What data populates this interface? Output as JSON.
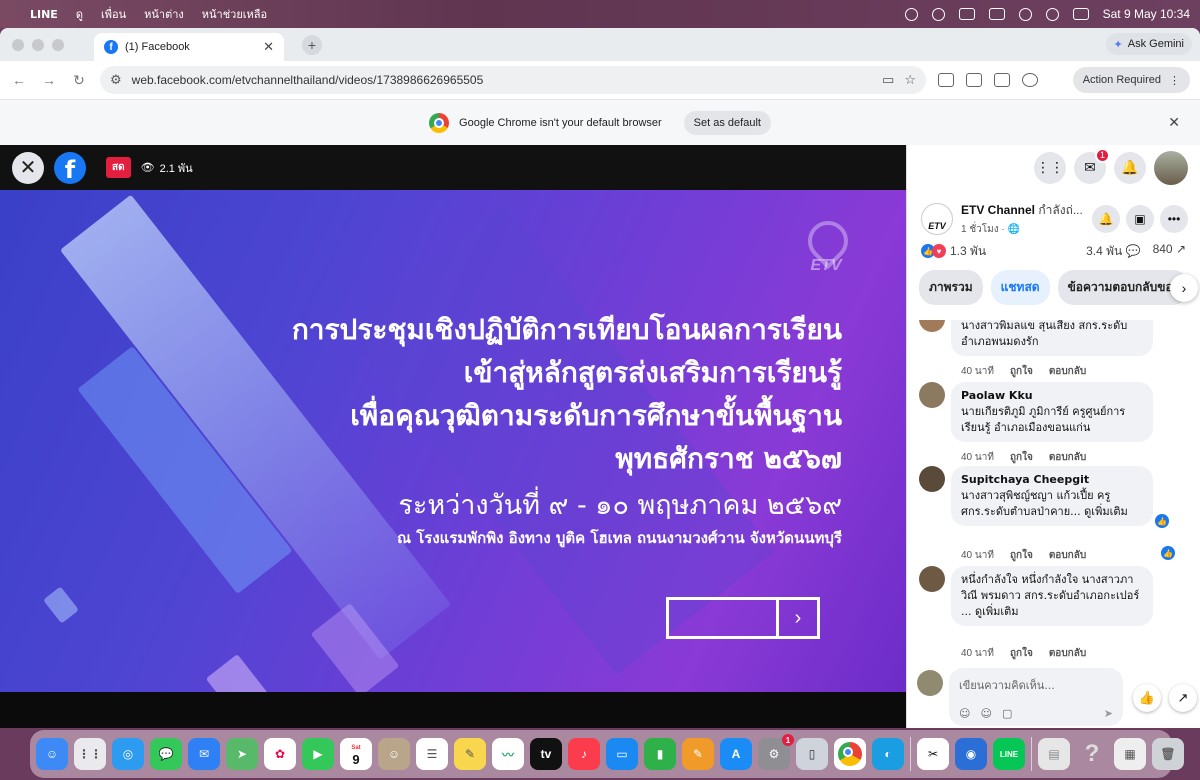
{
  "menubar": {
    "app": "LINE",
    "items": [
      "ดู",
      "เพื่อน",
      "หน้าต่าง",
      "หน้าช่วยเหลือ"
    ],
    "datetime": "Sat 9 May  10:34"
  },
  "browser": {
    "tab_title": "(1) Facebook",
    "gemini_label": "Ask Gemini",
    "url": "web.facebook.com/etvchannelthailand/videos/1738986626965505",
    "action_required": "Action Required",
    "infobar_text": "Google Chrome isn't your default browser",
    "set_default_label": "Set as default"
  },
  "video": {
    "live_label": "สด",
    "viewers": "2.1 พัน",
    "slide_logo": "ETV",
    "slide_lines": [
      "การประชุมเชิงปฏิบัติการเทียบโอนผลการเรียน",
      "เข้าสู่หลักสูตรส่งเสริมการเรียนรู้",
      "เพื่อคุณวุฒิตามระดับการศึกษาขั้นพื้นฐาน",
      "พุทธศักราช ๒๕๖๗"
    ],
    "slide_date": "ระหว่างวันที่ ๙ - ๑๐ พฤษภาคม ๒๕๖๙",
    "slide_venue": "ณ โรงแรมพักพิง อิงทาง บูติค โฮเทล ถนนงามวงศ์วาน จังหวัดนนทบุรี"
  },
  "panel": {
    "messenger_badge": "1",
    "page_name": "ETV Channel",
    "page_status": "กำลังถ่...",
    "page_time": "1 ชั่วโมง · 🌐",
    "page_logo": "ETV",
    "reactions": "1.3 พัน",
    "comments_count": "3.4 พัน",
    "shares_count": "840",
    "tabs": [
      "ภาพรวม",
      "แชทสด",
      "ข้อความตอบกลับของ"
    ],
    "comments": [
      {
        "name": "",
        "text": "นางสาวพิมลแข สุนเสียง สกร.ระดับอำเภอพนมดงรัก",
        "time": "40 นาที",
        "like": "ถูกใจ",
        "reply": "ตอบกลับ"
      },
      {
        "name": "Paolaw Kku",
        "text": "นายเกียรติภูมิ ภูมิการีย์ ครูศูนย์การเรียนรู้ อำเภอเมืองขอนแก่น",
        "time": "40 นาที",
        "like": "ถูกใจ",
        "reply": "ตอบกลับ"
      },
      {
        "name": "Supitchaya Cheepgit",
        "text": "นางสาวสุพิชญ์ชญา แก้วเปี้ย ครูศกร.ระดับตำบลป่าคาย... ดูเพิ่มเติม",
        "time": "40 นาที",
        "like": "ถูกใจ",
        "reply": "ตอบกลับ"
      },
      {
        "name": "",
        "text": "หนึ่งกำลังใจ หนึ่งกำลังใจ นางสาวภาวิณี พรมดาว สกร.ระดับอำเภอกะเปอร์ ... ดูเพิ่มเติม",
        "time": "40 นาที",
        "like": "ถูกใจ",
        "reply": "ตอบกลับ"
      }
    ],
    "composer_placeholder": "เขียนความคิดเห็น..."
  },
  "dock": {
    "calendar_day": "9",
    "calendar_month": "Sat",
    "settings_badge": "1",
    "tv_label": "tv",
    "line_label": "LINE"
  }
}
